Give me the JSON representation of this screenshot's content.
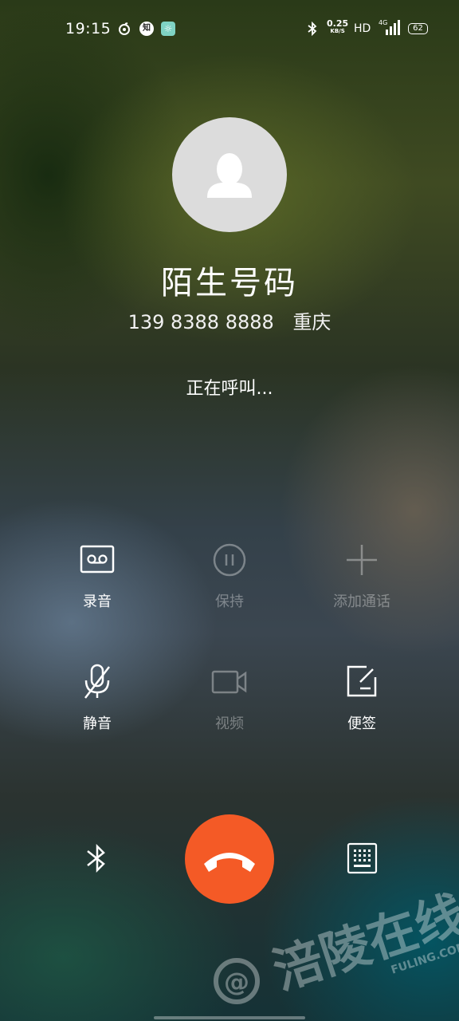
{
  "status_bar": {
    "time": "19:15",
    "speed_value": "0.25",
    "speed_unit": "KB/S",
    "hd": "HD",
    "network": "4G",
    "battery": "62"
  },
  "contact": {
    "name": "陌生号码",
    "number": "139 8388 8888",
    "location": "重庆",
    "call_status": "正在呼叫..."
  },
  "controls": [
    {
      "label": "录音",
      "icon": "voicemail-icon",
      "enabled": true
    },
    {
      "label": "保持",
      "icon": "pause-icon",
      "enabled": false
    },
    {
      "label": "添加通话",
      "icon": "plus-icon",
      "enabled": false
    },
    {
      "label": "静音",
      "icon": "mic-off-icon",
      "enabled": true
    },
    {
      "label": "视频",
      "icon": "video-camera-icon",
      "enabled": false
    },
    {
      "label": "便签",
      "icon": "note-icon",
      "enabled": true
    }
  ],
  "bottom": {
    "left_icon": "bluetooth-icon",
    "center_icon": "end-call-icon",
    "right_icon": "dialpad-icon"
  },
  "watermark": {
    "text": "涪陵在线",
    "domain": "FULING.COM"
  },
  "colors": {
    "end_call": "#f45a26",
    "avatar_bg": "#dcdcdc"
  }
}
